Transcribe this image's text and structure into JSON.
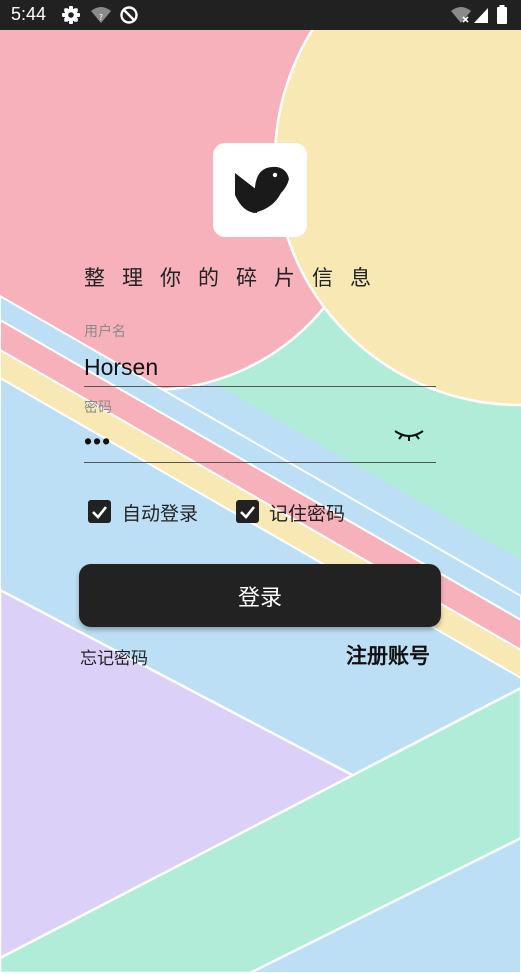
{
  "status_bar": {
    "time": "5:44",
    "icons": [
      "settings-gear-icon",
      "wifi-question-icon",
      "data-saver-icon",
      "wifi-off-icon",
      "signal-icon",
      "battery-icon"
    ]
  },
  "header": {
    "logo_icon": "bird-logo-icon",
    "slogan": "整理你的碎片信息"
  },
  "form": {
    "username_label": "用户名",
    "username_value": "Horsen",
    "password_label": "密码",
    "password_value": "•••",
    "password_visibility_icon": "eye-closed-icon"
  },
  "options": {
    "auto_login_label": "自动登录",
    "auto_login_checked": true,
    "remember_password_label": "记住密码",
    "remember_password_checked": true
  },
  "actions": {
    "login_label": "登录",
    "forgot_password_label": "忘记密码",
    "register_label": "注册账号"
  },
  "colors": {
    "pink": "#f7b1bb",
    "yellow": "#f7e8b4",
    "mint": "#b0ecd8",
    "blue": "#bcdff5",
    "lavender": "#dbd0f7",
    "dark": "#222222"
  }
}
